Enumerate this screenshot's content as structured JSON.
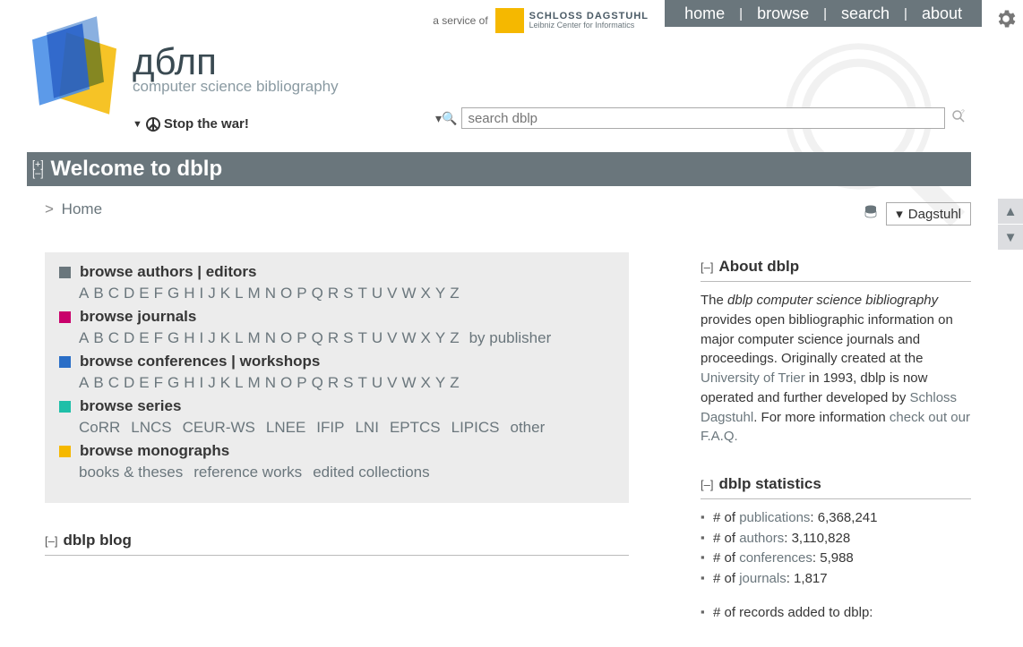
{
  "topnav": {
    "home": "home",
    "browse": "browse",
    "search": "search",
    "about": "about"
  },
  "serviceof": {
    "prefix": "a service of",
    "line1": "SCHLOSS DAGSTUHL",
    "line2": "Leibniz Center for Informatics"
  },
  "logo": {
    "title": "дблп",
    "subtitle": "computer science bibliography"
  },
  "stopwar": "Stop the war!",
  "search": {
    "placeholder": "search dblp"
  },
  "header": {
    "title": "Welcome to dblp",
    "plus": "[+]",
    "minus": "[–]"
  },
  "crumb": {
    "gt": ">",
    "home": "Home"
  },
  "mirror": {
    "label": "Dagstuhl"
  },
  "browse": {
    "authors": {
      "label": "browse authors | editors",
      "color": "#6a767c"
    },
    "journals": {
      "label": "browse journals",
      "color": "#c9006b",
      "bypub": "by publisher"
    },
    "conferences": {
      "label": "browse conferences | workshops",
      "color": "#2a6ec7"
    },
    "series": {
      "label": "browse series",
      "color": "#1fbfa8",
      "items": [
        "CoRR",
        "LNCS",
        "CEUR-WS",
        "LNEE",
        "IFIP",
        "LNI",
        "EPTCS",
        "LIPICS",
        "other"
      ]
    },
    "monographs": {
      "label": "browse monographs",
      "color": "#f5b800",
      "items": [
        "books & theses",
        "reference works",
        "edited collections"
      ]
    },
    "letters": [
      "A",
      "B",
      "C",
      "D",
      "E",
      "F",
      "G",
      "H",
      "I",
      "J",
      "K",
      "L",
      "M",
      "N",
      "O",
      "P",
      "Q",
      "R",
      "S",
      "T",
      "U",
      "V",
      "W",
      "X",
      "Y",
      "Z"
    ]
  },
  "blog": {
    "title": "dblp blog",
    "toggle": "[–]"
  },
  "about": {
    "title": "About dblp",
    "toggle": "[–]",
    "text_pre": "The ",
    "em": "dblp computer science bibliography",
    "text_mid": " provides open bibliographic information on major computer science journals and proceedings. Originally created at the ",
    "link1": "University of Trier",
    "text_mid2": " in 1993, dblp is now operated and further developed by ",
    "link2": "Schloss Dagstuhl",
    "text_end": ". For more information ",
    "link3": "check out our F.A.Q."
  },
  "stats": {
    "title": "dblp statistics",
    "toggle": "[–]",
    "items": [
      {
        "prefix": "# of ",
        "link": "publications",
        "value": ": 6,368,241"
      },
      {
        "prefix": "# of ",
        "link": "authors",
        "value": ": 3,110,828"
      },
      {
        "prefix": "# of ",
        "link": "conferences",
        "value": ": 5,988"
      },
      {
        "prefix": "# of ",
        "link": "journals",
        "value": ": 1,817"
      }
    ],
    "records_added": "# of records added to dblp:"
  }
}
